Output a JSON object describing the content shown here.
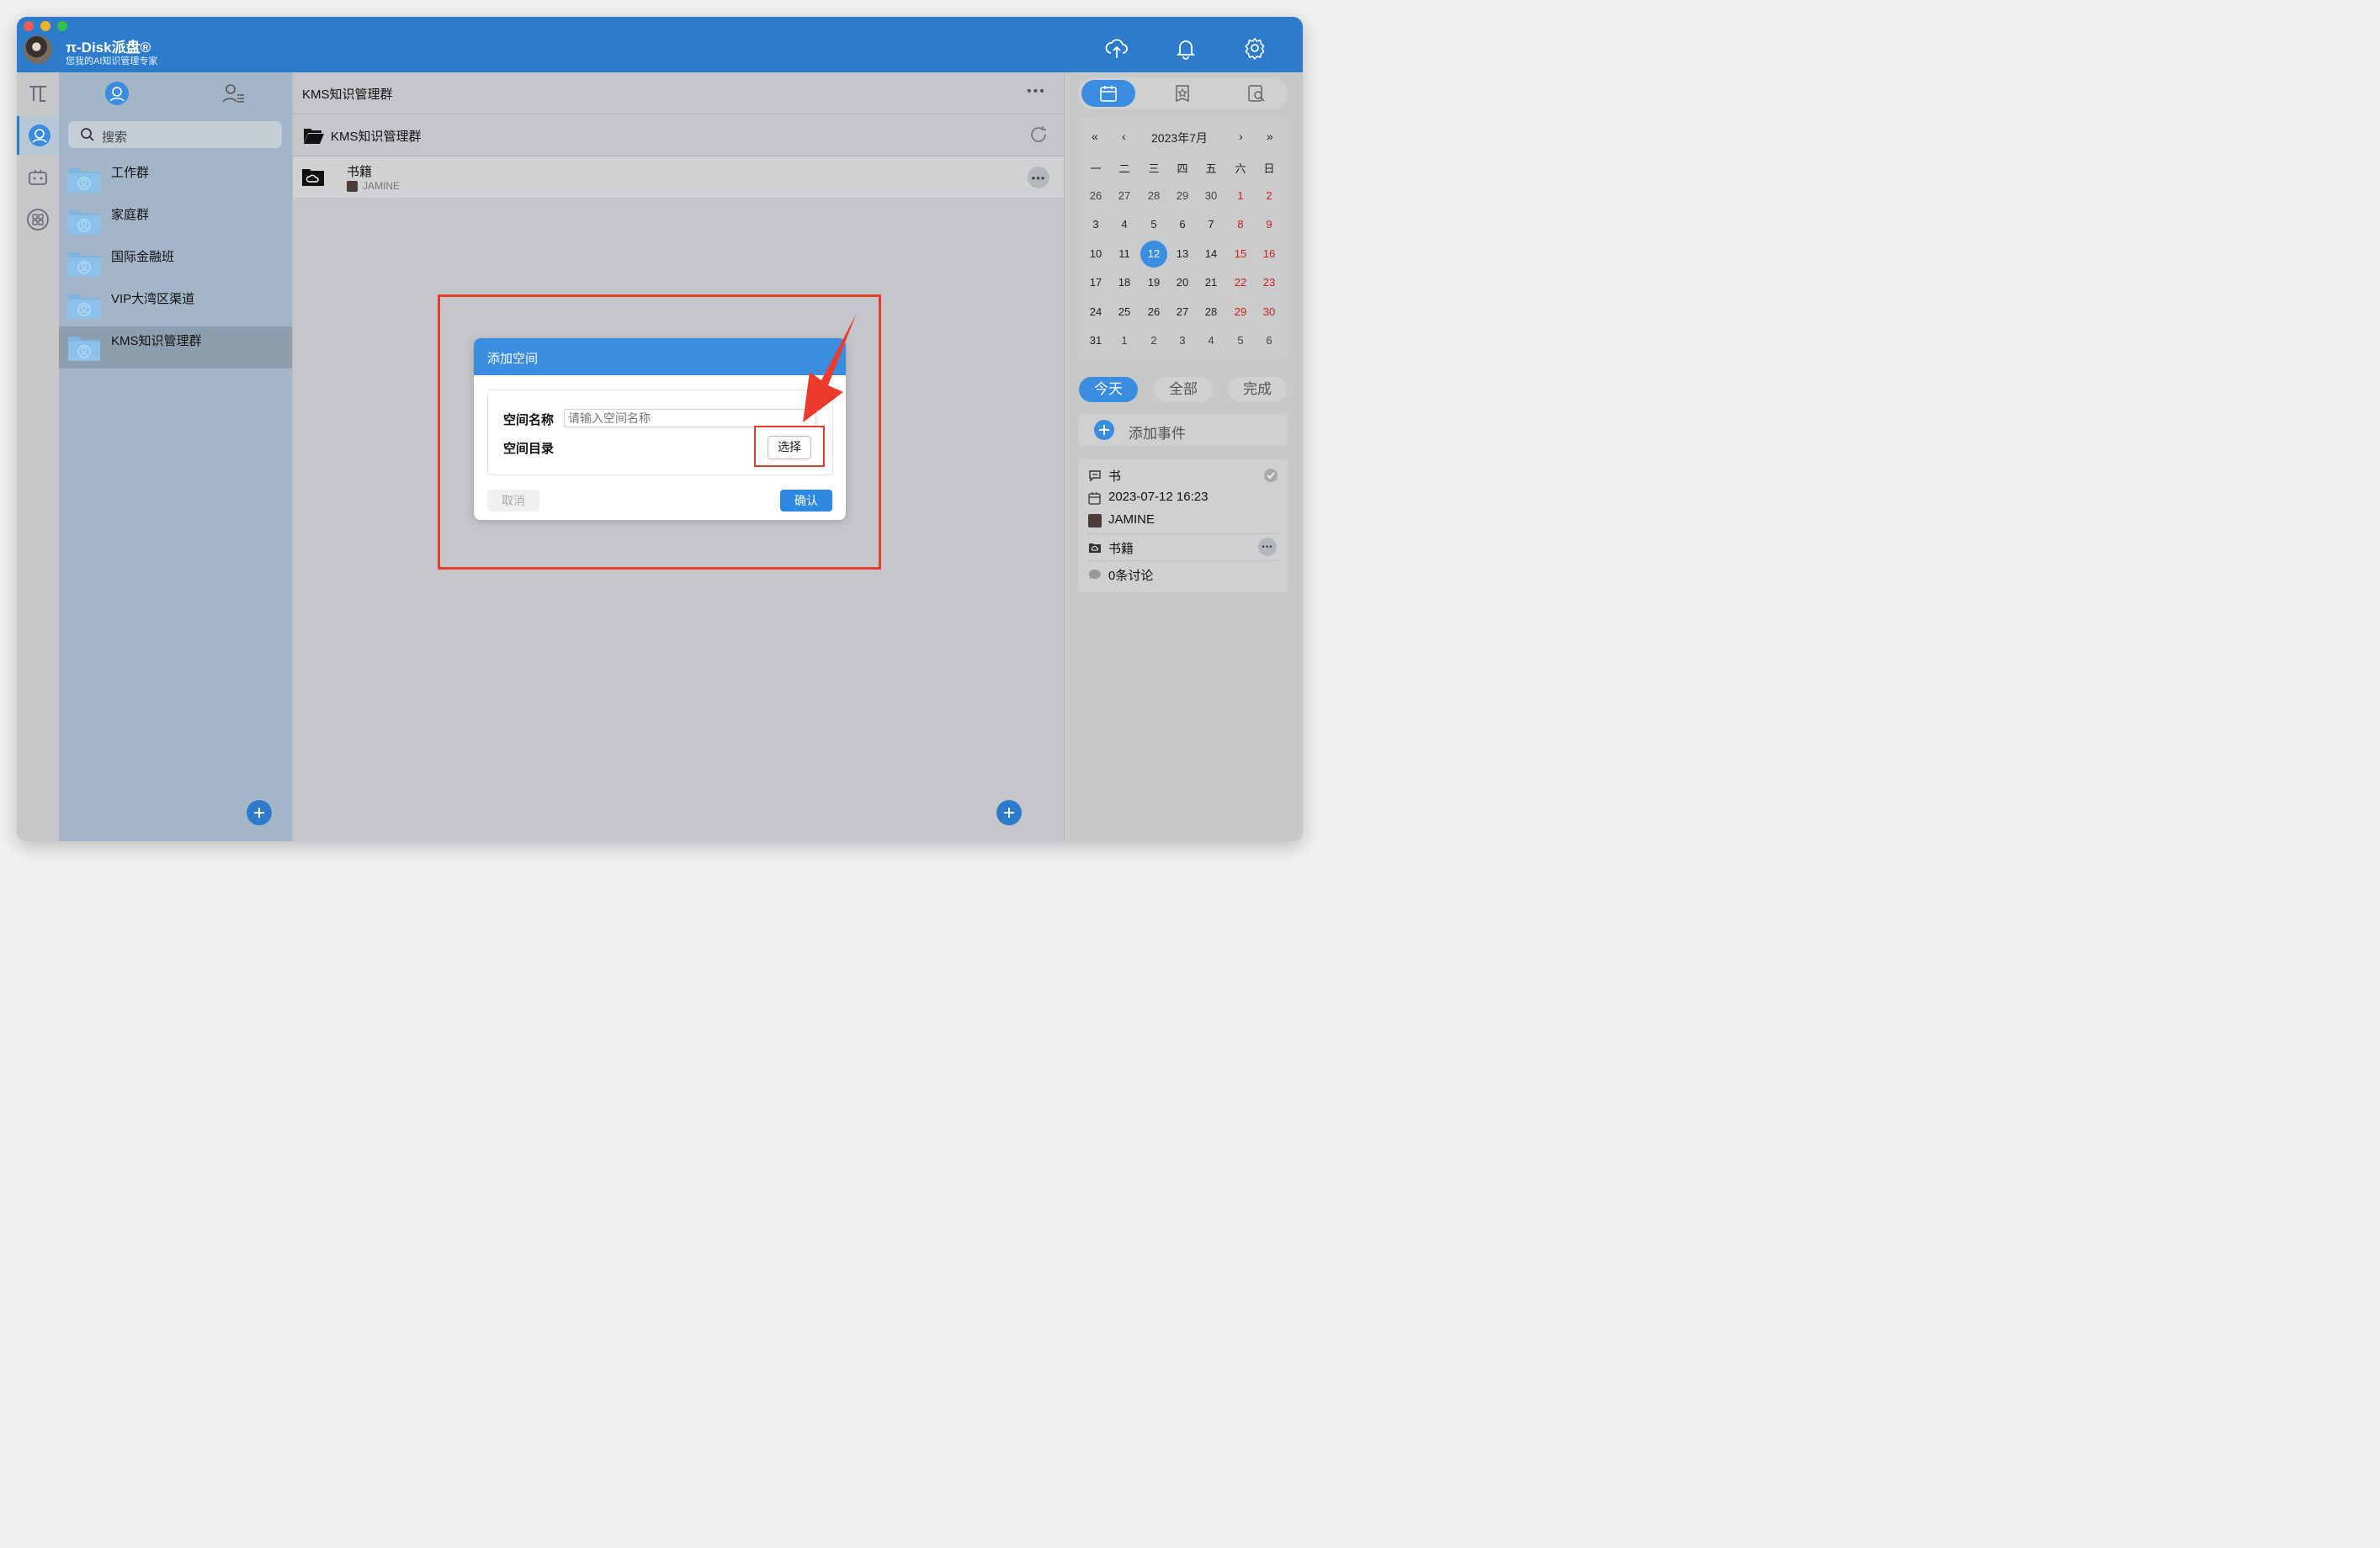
{
  "app": {
    "title": "π-Disk派盘®",
    "subtitle": "您我的AI知识管理专家",
    "header_icons": [
      "cloud-upload-icon",
      "bell-icon",
      "gear-icon"
    ]
  },
  "rail": {
    "items": [
      "pi-logo-icon",
      "group-icon",
      "robot-icon",
      "apps-icon"
    ]
  },
  "groups": {
    "search_placeholder": "搜索",
    "items": [
      {
        "label": "工作群"
      },
      {
        "label": "家庭群"
      },
      {
        "label": "国际金融班"
      },
      {
        "label": "VIP大湾区渠道"
      },
      {
        "label": "KMS知识管理群"
      }
    ],
    "selected_index": 4
  },
  "main": {
    "title": "KMS知识管理群",
    "breadcrumb": "KMS知识管理群",
    "rows": [
      {
        "name": "书籍",
        "owner": "JAMINE"
      }
    ]
  },
  "dialog": {
    "title": "添加空间",
    "name_label": "空间名称",
    "name_placeholder": "请输入空间名称",
    "dir_label": "空间目录",
    "choose_label": "选择",
    "cancel_label": "取消",
    "confirm_label": "确认"
  },
  "calendar": {
    "month_label": "2023年7月",
    "nav": {
      "prev_year": "«",
      "prev_month": "‹",
      "next_month": "›",
      "next_year": "»"
    },
    "weekdays": [
      "一",
      "二",
      "三",
      "四",
      "五",
      "六",
      "日"
    ],
    "weeks": [
      [
        "26",
        "27",
        "28",
        "29",
        "30",
        "1",
        "2"
      ],
      [
        "3",
        "4",
        "5",
        "6",
        "7",
        "8",
        "9"
      ],
      [
        "10",
        "11",
        "12",
        "13",
        "14",
        "15",
        "16"
      ],
      [
        "17",
        "18",
        "19",
        "20",
        "21",
        "22",
        "23"
      ],
      [
        "24",
        "25",
        "26",
        "27",
        "28",
        "29",
        "30"
      ],
      [
        "31",
        "1",
        "2",
        "3",
        "4",
        "5",
        "6"
      ]
    ],
    "today": "12"
  },
  "filters": {
    "today": "今天",
    "all": "全部",
    "done": "完成"
  },
  "add_event_label": "添加事件",
  "event": {
    "title": "书",
    "datetime": "2023-07-12 16:23",
    "user": "JAMINE",
    "space": "书籍",
    "comments": "0条讨论"
  },
  "colors": {
    "accent": "#2d7ccc",
    "highlight": "#e83c2f",
    "weekend": "#d21c1c"
  }
}
